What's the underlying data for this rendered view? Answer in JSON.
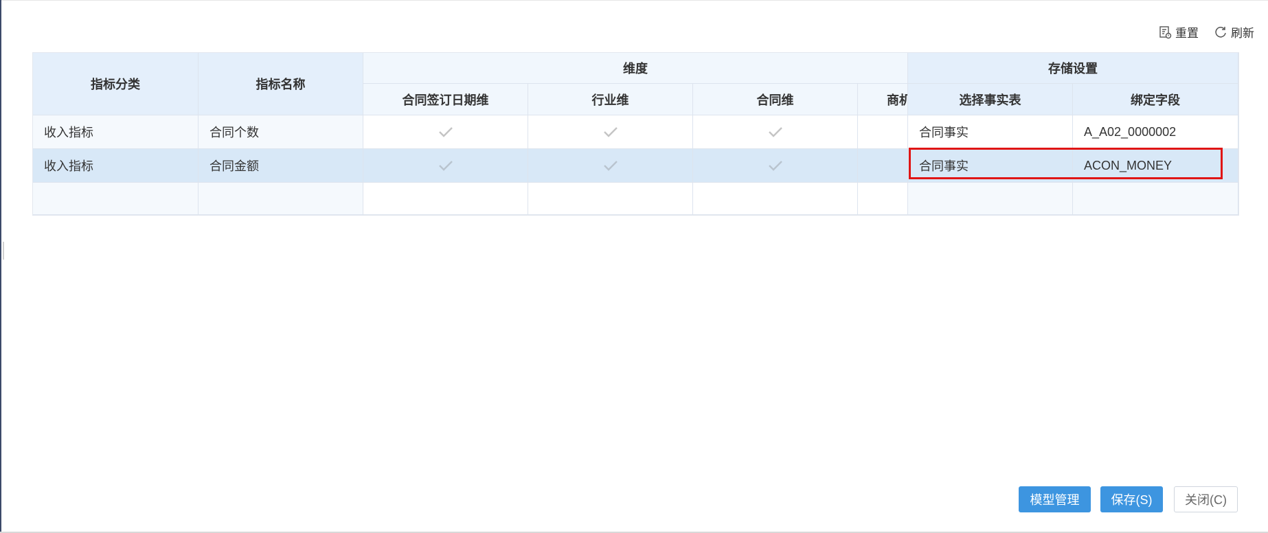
{
  "toolbar": {
    "reset_label": "重置",
    "refresh_label": "刷新"
  },
  "table": {
    "headers": {
      "category": "指标分类",
      "name": "指标名称",
      "dimension_group": "维度",
      "storage_group": "存储设置",
      "dims": [
        "合同签订日期维",
        "行业维",
        "合同维",
        "商机"
      ],
      "fact_table": "选择事实表",
      "bind_field": "绑定字段"
    },
    "rows": [
      {
        "category": "收入指标",
        "name": "合同个数",
        "dims": [
          true,
          true,
          true,
          false
        ],
        "fact_table": "合同事实",
        "bind_field": "A_A02_0000002"
      },
      {
        "category": "收入指标",
        "name": "合同金额",
        "dims": [
          true,
          true,
          true,
          false
        ],
        "fact_table": "合同事实",
        "bind_field": "ACON_MONEY"
      },
      {
        "category": "",
        "name": "",
        "dims": [
          false,
          false,
          false,
          false
        ],
        "fact_table": "",
        "bind_field": ""
      }
    ]
  },
  "footer": {
    "model_label": "模型管理",
    "save_label": "保存(S)",
    "close_label": "关闭(C)"
  }
}
